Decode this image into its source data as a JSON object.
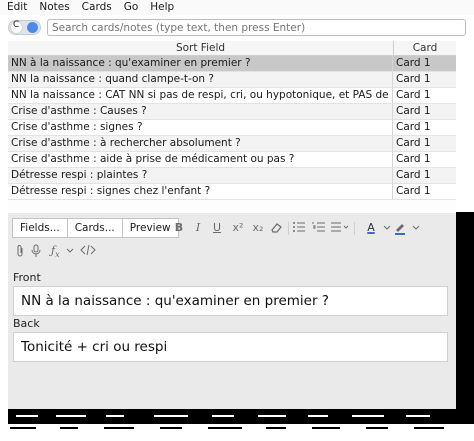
{
  "menu": [
    "Edit",
    "Notes",
    "Cards",
    "Go",
    "Help"
  ],
  "search": {
    "toggle_letter": "C",
    "placeholder": "Search cards/notes (type text, then press Enter)"
  },
  "table": {
    "headers": {
      "sort_field": "Sort Field",
      "card": "Card"
    },
    "rows": [
      {
        "sort_field": "NN à la naissance : qu'examiner en premier ?",
        "card": "Card 1",
        "selected": true
      },
      {
        "sort_field": "NN la naissance : quand clampe-t-on ?",
        "card": "Card 1"
      },
      {
        "sort_field": "NN la naissance : CAT NN si pas de respi, cri, ou hypotonique, et PAS de mesure de pouls",
        "card": "Card 1"
      },
      {
        "sort_field": "Crise d'asthme : Causes ?",
        "card": "Card 1"
      },
      {
        "sort_field": "Crise d'asthme : signes ?",
        "card": "Card 1"
      },
      {
        "sort_field": "Crise d'asthme : à rechercher absolument ?",
        "card": "Card 1"
      },
      {
        "sort_field": "Crise d'asthme : aide à prise de médicament ou pas ?",
        "card": "Card 1"
      },
      {
        "sort_field": "Détresse respi : plaintes ?",
        "card": "Card 1"
      },
      {
        "sort_field": "Détresse respi : signes chez l'enfant ?",
        "card": "Card 1"
      }
    ]
  },
  "editor": {
    "buttons": {
      "fields": "Fields...",
      "cards": "Cards...",
      "preview": "Preview"
    },
    "format": {
      "bold": "B",
      "italic": "I",
      "underline": "U",
      "superscript": "x²",
      "subscript": "x₂",
      "text_color": "A"
    },
    "fields": [
      {
        "label": "Front",
        "value": "NN à la naissance : qu'examiner en premier ?"
      },
      {
        "label": "Back",
        "value": "Tonicité + cri ou respi"
      }
    ]
  }
}
